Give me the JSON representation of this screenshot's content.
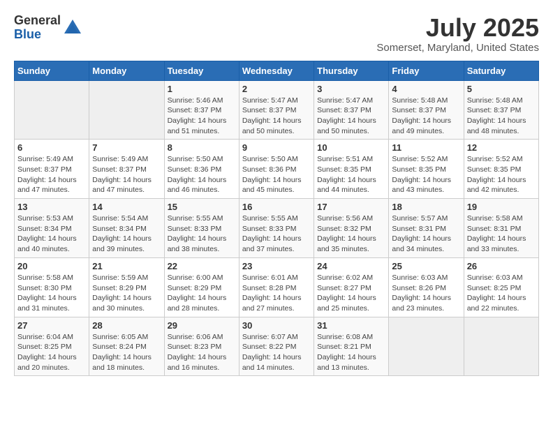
{
  "header": {
    "logo_general": "General",
    "logo_blue": "Blue",
    "title": "July 2025",
    "location": "Somerset, Maryland, United States"
  },
  "calendar": {
    "weekdays": [
      "Sunday",
      "Monday",
      "Tuesday",
      "Wednesday",
      "Thursday",
      "Friday",
      "Saturday"
    ],
    "weeks": [
      [
        {
          "day": "",
          "info": ""
        },
        {
          "day": "",
          "info": ""
        },
        {
          "day": "1",
          "info": "Sunrise: 5:46 AM\nSunset: 8:37 PM\nDaylight: 14 hours\nand 51 minutes."
        },
        {
          "day": "2",
          "info": "Sunrise: 5:47 AM\nSunset: 8:37 PM\nDaylight: 14 hours\nand 50 minutes."
        },
        {
          "day": "3",
          "info": "Sunrise: 5:47 AM\nSunset: 8:37 PM\nDaylight: 14 hours\nand 50 minutes."
        },
        {
          "day": "4",
          "info": "Sunrise: 5:48 AM\nSunset: 8:37 PM\nDaylight: 14 hours\nand 49 minutes."
        },
        {
          "day": "5",
          "info": "Sunrise: 5:48 AM\nSunset: 8:37 PM\nDaylight: 14 hours\nand 48 minutes."
        }
      ],
      [
        {
          "day": "6",
          "info": "Sunrise: 5:49 AM\nSunset: 8:37 PM\nDaylight: 14 hours\nand 47 minutes."
        },
        {
          "day": "7",
          "info": "Sunrise: 5:49 AM\nSunset: 8:37 PM\nDaylight: 14 hours\nand 47 minutes."
        },
        {
          "day": "8",
          "info": "Sunrise: 5:50 AM\nSunset: 8:36 PM\nDaylight: 14 hours\nand 46 minutes."
        },
        {
          "day": "9",
          "info": "Sunrise: 5:50 AM\nSunset: 8:36 PM\nDaylight: 14 hours\nand 45 minutes."
        },
        {
          "day": "10",
          "info": "Sunrise: 5:51 AM\nSunset: 8:35 PM\nDaylight: 14 hours\nand 44 minutes."
        },
        {
          "day": "11",
          "info": "Sunrise: 5:52 AM\nSunset: 8:35 PM\nDaylight: 14 hours\nand 43 minutes."
        },
        {
          "day": "12",
          "info": "Sunrise: 5:52 AM\nSunset: 8:35 PM\nDaylight: 14 hours\nand 42 minutes."
        }
      ],
      [
        {
          "day": "13",
          "info": "Sunrise: 5:53 AM\nSunset: 8:34 PM\nDaylight: 14 hours\nand 40 minutes."
        },
        {
          "day": "14",
          "info": "Sunrise: 5:54 AM\nSunset: 8:34 PM\nDaylight: 14 hours\nand 39 minutes."
        },
        {
          "day": "15",
          "info": "Sunrise: 5:55 AM\nSunset: 8:33 PM\nDaylight: 14 hours\nand 38 minutes."
        },
        {
          "day": "16",
          "info": "Sunrise: 5:55 AM\nSunset: 8:33 PM\nDaylight: 14 hours\nand 37 minutes."
        },
        {
          "day": "17",
          "info": "Sunrise: 5:56 AM\nSunset: 8:32 PM\nDaylight: 14 hours\nand 35 minutes."
        },
        {
          "day": "18",
          "info": "Sunrise: 5:57 AM\nSunset: 8:31 PM\nDaylight: 14 hours\nand 34 minutes."
        },
        {
          "day": "19",
          "info": "Sunrise: 5:58 AM\nSunset: 8:31 PM\nDaylight: 14 hours\nand 33 minutes."
        }
      ],
      [
        {
          "day": "20",
          "info": "Sunrise: 5:58 AM\nSunset: 8:30 PM\nDaylight: 14 hours\nand 31 minutes."
        },
        {
          "day": "21",
          "info": "Sunrise: 5:59 AM\nSunset: 8:29 PM\nDaylight: 14 hours\nand 30 minutes."
        },
        {
          "day": "22",
          "info": "Sunrise: 6:00 AM\nSunset: 8:29 PM\nDaylight: 14 hours\nand 28 minutes."
        },
        {
          "day": "23",
          "info": "Sunrise: 6:01 AM\nSunset: 8:28 PM\nDaylight: 14 hours\nand 27 minutes."
        },
        {
          "day": "24",
          "info": "Sunrise: 6:02 AM\nSunset: 8:27 PM\nDaylight: 14 hours\nand 25 minutes."
        },
        {
          "day": "25",
          "info": "Sunrise: 6:03 AM\nSunset: 8:26 PM\nDaylight: 14 hours\nand 23 minutes."
        },
        {
          "day": "26",
          "info": "Sunrise: 6:03 AM\nSunset: 8:25 PM\nDaylight: 14 hours\nand 22 minutes."
        }
      ],
      [
        {
          "day": "27",
          "info": "Sunrise: 6:04 AM\nSunset: 8:25 PM\nDaylight: 14 hours\nand 20 minutes."
        },
        {
          "day": "28",
          "info": "Sunrise: 6:05 AM\nSunset: 8:24 PM\nDaylight: 14 hours\nand 18 minutes."
        },
        {
          "day": "29",
          "info": "Sunrise: 6:06 AM\nSunset: 8:23 PM\nDaylight: 14 hours\nand 16 minutes."
        },
        {
          "day": "30",
          "info": "Sunrise: 6:07 AM\nSunset: 8:22 PM\nDaylight: 14 hours\nand 14 minutes."
        },
        {
          "day": "31",
          "info": "Sunrise: 6:08 AM\nSunset: 8:21 PM\nDaylight: 14 hours\nand 13 minutes."
        },
        {
          "day": "",
          "info": ""
        },
        {
          "day": "",
          "info": ""
        }
      ]
    ]
  }
}
